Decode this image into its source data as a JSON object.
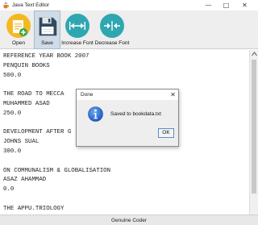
{
  "window": {
    "title": "Java Text Editor",
    "minimize_glyph": "—",
    "maximize_glyph": "□",
    "close_glyph": "✕"
  },
  "toolbar": {
    "open_label": "Open",
    "save_label": "Save",
    "increase_font_label": "Increase Font",
    "decrease_font_label": "Decrease Font",
    "icons": {
      "open": "folder-plus-icon",
      "save": "floppy-disk-icon",
      "increase_font": "expand-arrows-icon",
      "decrease_font": "collapse-arrows-icon"
    }
  },
  "editor": {
    "lines": [
      "REFERENCE YEAR BOOK 2007",
      "PENQUIN BOOKS",
      "500.0",
      "",
      "THE ROAD TO MECCA",
      "MUHAMMED ASAD",
      "250.0",
      "",
      "DEVELOPMENT AFTER G",
      "JOHNS SUAL",
      "300.0",
      "",
      "ON COMMUNALISM & GLOBALISATION",
      "ASAZ AHAMMAD",
      "0.0",
      "",
      "THE APPU.TRIOLOGY"
    ]
  },
  "status": {
    "text": "Genuine Coder"
  },
  "dialog": {
    "title": "Done",
    "close_glyph": "✕",
    "message": "Saved to bookdata.txt",
    "ok_label": "OK",
    "icon": "info-icon"
  },
  "colors": {
    "toolbar_bg": "#eeeeee",
    "open_icon_yellow": "#f5b820",
    "save_icon_navy": "#34495e",
    "font_icon_teal": "#2fa7b0",
    "info_icon_blue": "#2a6fd6",
    "selected_button_bg": "#cfdbe6"
  }
}
